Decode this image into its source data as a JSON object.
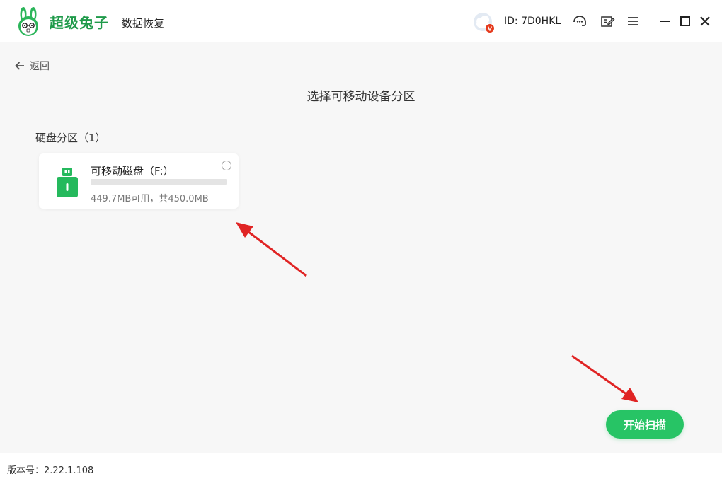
{
  "header": {
    "brand_name": "超级兔子",
    "brand_sub": "数据恢复",
    "user_id": "ID: 7D0HKL",
    "vip_badge": "V",
    "icons": [
      "support-icon",
      "feedback-icon",
      "menu-icon",
      "minimize-icon",
      "maximize-icon",
      "close-icon"
    ]
  },
  "nav": {
    "back_label": "返回"
  },
  "main": {
    "title": "选择可移动设备分区",
    "section_label": "硬盘分区（1）",
    "partitions": [
      {
        "name": "可移动磁盘（F:）",
        "size_text": "449.7MB可用，共450.0MB",
        "used_fraction": 0.0007,
        "selected": false
      }
    ],
    "start_button": "开始扫描"
  },
  "footer": {
    "version": "版本号：2.22.1.108"
  },
  "colors": {
    "accent": "#27c465",
    "brand": "#1f9a4a",
    "annotation_arrow": "#e02424"
  }
}
